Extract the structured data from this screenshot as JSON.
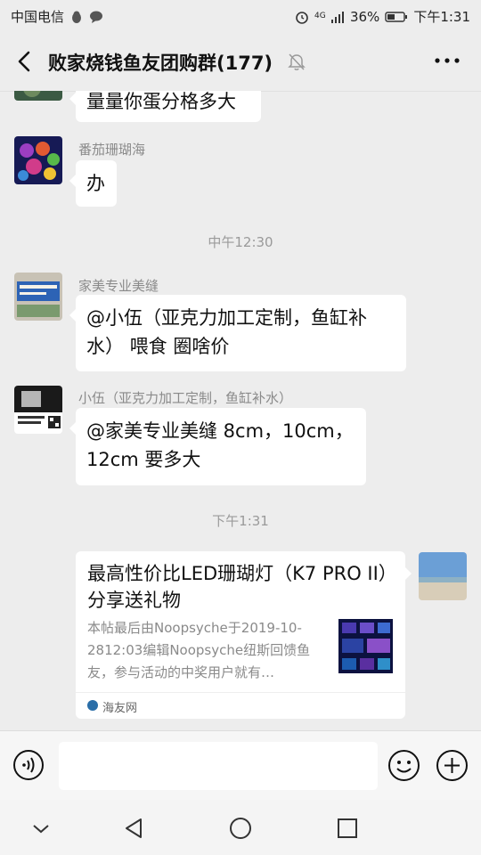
{
  "status_bar": {
    "carrier": "中国电信",
    "network": "4G",
    "battery": "36%",
    "time": "下午1:31"
  },
  "header": {
    "title": "败家烧钱鱼友团购群(177)",
    "icons": {
      "back": "back-arrow-icon",
      "mute": "bell-off-icon",
      "more": "more-dots-icon"
    }
  },
  "messages": [
    {
      "text": "量量你蛋分格多大"
    },
    {
      "sender": "番茄珊瑚海",
      "text": "办"
    },
    {
      "timestamp": "中午12:30"
    },
    {
      "sender": "家美专业美缝",
      "text": "@小伍（亚克力加工定制，鱼缸补水） 喂食 圈啥价"
    },
    {
      "sender": "小伍（亚克力加工定制，鱼缸补水）",
      "text": "@家美专业美缝 8cm，10cm，12cm 要多大"
    },
    {
      "timestamp": "下午1:31"
    }
  ],
  "link_card": {
    "title": "最高性价比LED珊瑚灯（K7 PRO II）分享送礼物",
    "description": "本帖最后由Noopsyche于2019-10-2812:03编辑Noopsyche纽斯回馈鱼友，参与活动的中奖用户就有…",
    "source": "海友网"
  },
  "input_bar": {
    "placeholder": "",
    "icons": {
      "voice": "voice-icon",
      "emoji": "emoji-icon",
      "plus": "plus-icon"
    }
  },
  "nav_bar": {
    "icons": [
      "down-chevron-icon",
      "back-triangle-icon",
      "home-circle-icon",
      "recents-square-icon"
    ]
  },
  "colors": {
    "background": "#ededed",
    "bubble": "#ffffff",
    "sender_text": "#8a8a8a"
  }
}
